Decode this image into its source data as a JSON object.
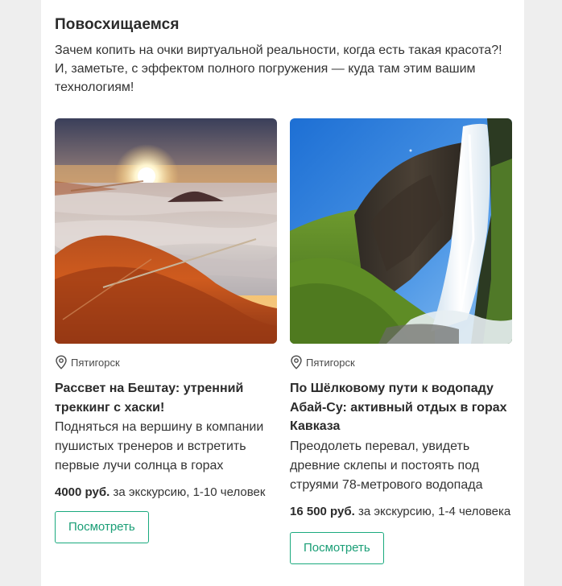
{
  "section": {
    "title": "Повосхищаемся",
    "intro": "Зачем копить на очки виртуальной реальности, когда есть такая красота?! И, заметьте, с эффектом полного погружения — куда там этим вашим технологиям!"
  },
  "cards": [
    {
      "image_icon": "sunrise-photo",
      "location": "Пятигорск",
      "title": "Рассвет на Бештау: утренний треккинг с хаски!",
      "description": "Подняться на вершину в компании пушистых тренеров и встретить первые лучи солнца в горах",
      "price": "4000 руб.",
      "price_note": "за экскурсию, 1-10 человек",
      "button_label": "Посмотреть"
    },
    {
      "image_icon": "waterfall-photo",
      "location": "Пятигорск",
      "title": "По Шёлковому пути к водопаду Абай-Су: активный отдых в горах Кавказа",
      "description": "Преодолеть перевал, увидеть древние склепы и постоять под струями 78-метрового водопада",
      "price": "16 500 руб.",
      "price_note": "за экскурсию, 1-4 человека",
      "button_label": "Посмотреть"
    }
  ],
  "colors": {
    "accent": "#1aaa7e",
    "text": "#333333",
    "background": "#eeeeee"
  }
}
